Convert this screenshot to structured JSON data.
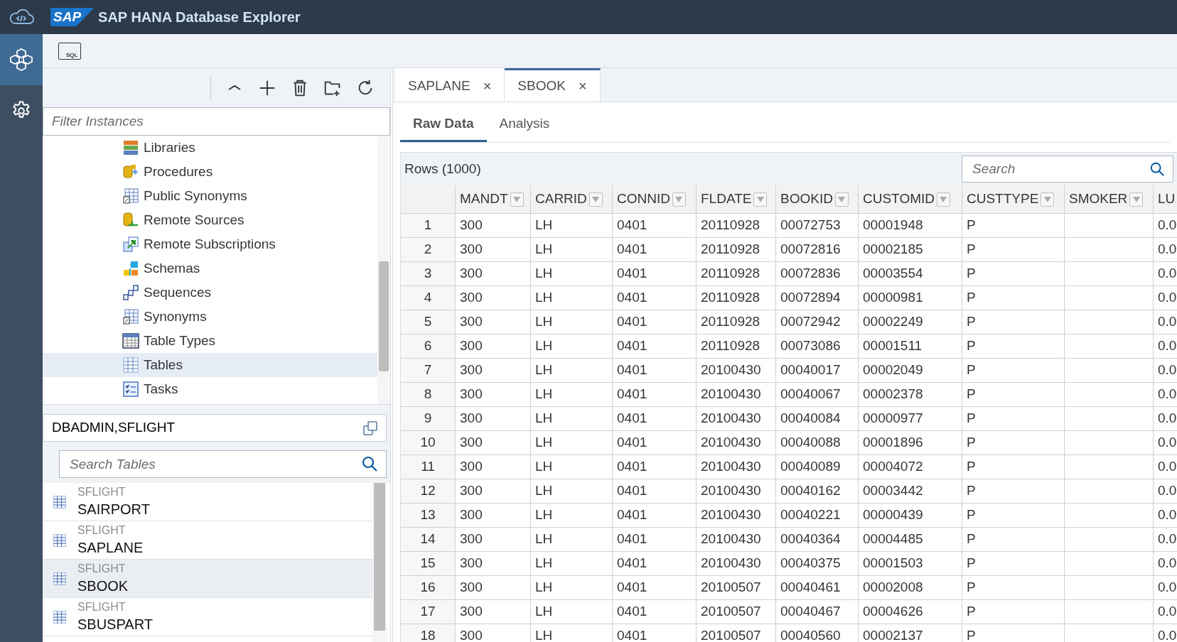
{
  "window": {
    "title": "SAP HANA Database Explorer",
    "logo": "SAP"
  },
  "rail": [
    {
      "selected": true
    },
    {
      "selected": false
    }
  ],
  "toolbar": {
    "sql_label": "SQL"
  },
  "filter": {
    "placeholder": "Filter Instances"
  },
  "tree": [
    {
      "label": "Libraries",
      "selected": false
    },
    {
      "label": "Procedures",
      "selected": false
    },
    {
      "label": "Public Synonyms",
      "selected": false
    },
    {
      "label": "Remote Sources",
      "selected": false
    },
    {
      "label": "Remote Subscriptions",
      "selected": false
    },
    {
      "label": "Schemas",
      "selected": false
    },
    {
      "label": "Sequences",
      "selected": false
    },
    {
      "label": "Synonyms",
      "selected": false
    },
    {
      "label": "Table Types",
      "selected": false
    },
    {
      "label": "Tables",
      "selected": true
    },
    {
      "label": "Tasks",
      "selected": false
    }
  ],
  "connection": {
    "label": "DBADMIN,SFLIGHT"
  },
  "table_search": {
    "placeholder": "Search Tables"
  },
  "table_list": [
    {
      "schema": "SFLIGHT",
      "name": "SAIRPORT",
      "selected": false
    },
    {
      "schema": "SFLIGHT",
      "name": "SAPLANE",
      "selected": false
    },
    {
      "schema": "SFLIGHT",
      "name": "SBOOK",
      "selected": true
    },
    {
      "schema": "SFLIGHT",
      "name": "SBUSPART",
      "selected": false
    }
  ],
  "tabs": [
    {
      "label": "SAPLANE",
      "close": "×",
      "selected": false
    },
    {
      "label": "SBOOK",
      "close": "×",
      "selected": true
    }
  ],
  "subtabs": [
    {
      "label": "Raw Data",
      "selected": true
    },
    {
      "label": "Analysis",
      "selected": false
    }
  ],
  "grid": {
    "row_count": "Rows (1000)",
    "search_placeholder": "Search",
    "columns": [
      "",
      "MANDT",
      "CARRID",
      "CONNID",
      "FLDATE",
      "BOOKID",
      "CUSTOMID",
      "CUSTTYPE",
      "SMOKER",
      "LU"
    ],
    "rows": [
      [
        "1",
        "300",
        "LH",
        "0401",
        "20110928",
        "00072753",
        "00001948",
        "P",
        "",
        "0.0"
      ],
      [
        "2",
        "300",
        "LH",
        "0401",
        "20110928",
        "00072816",
        "00002185",
        "P",
        "",
        "0.0"
      ],
      [
        "3",
        "300",
        "LH",
        "0401",
        "20110928",
        "00072836",
        "00003554",
        "P",
        "",
        "0.0"
      ],
      [
        "4",
        "300",
        "LH",
        "0401",
        "20110928",
        "00072894",
        "00000981",
        "P",
        "",
        "0.0"
      ],
      [
        "5",
        "300",
        "LH",
        "0401",
        "20110928",
        "00072942",
        "00002249",
        "P",
        "",
        "0.0"
      ],
      [
        "6",
        "300",
        "LH",
        "0401",
        "20110928",
        "00073086",
        "00001511",
        "P",
        "",
        "0.0"
      ],
      [
        "7",
        "300",
        "LH",
        "0401",
        "20100430",
        "00040017",
        "00002049",
        "P",
        "",
        "0.0"
      ],
      [
        "8",
        "300",
        "LH",
        "0401",
        "20100430",
        "00040067",
        "00002378",
        "P",
        "",
        "0.0"
      ],
      [
        "9",
        "300",
        "LH",
        "0401",
        "20100430",
        "00040084",
        "00000977",
        "P",
        "",
        "0.0"
      ],
      [
        "10",
        "300",
        "LH",
        "0401",
        "20100430",
        "00040088",
        "00001896",
        "P",
        "",
        "0.0"
      ],
      [
        "11",
        "300",
        "LH",
        "0401",
        "20100430",
        "00040089",
        "00004072",
        "P",
        "",
        "0.0"
      ],
      [
        "12",
        "300",
        "LH",
        "0401",
        "20100430",
        "00040162",
        "00003442",
        "P",
        "",
        "0.0"
      ],
      [
        "13",
        "300",
        "LH",
        "0401",
        "20100430",
        "00040221",
        "00000439",
        "P",
        "",
        "0.0"
      ],
      [
        "14",
        "300",
        "LH",
        "0401",
        "20100430",
        "00040364",
        "00004485",
        "P",
        "",
        "0.0"
      ],
      [
        "15",
        "300",
        "LH",
        "0401",
        "20100430",
        "00040375",
        "00001503",
        "P",
        "",
        "0.0"
      ],
      [
        "16",
        "300",
        "LH",
        "0401",
        "20100507",
        "00040461",
        "00002008",
        "P",
        "",
        "0.0"
      ],
      [
        "17",
        "300",
        "LH",
        "0401",
        "20100507",
        "00040467",
        "00004626",
        "P",
        "",
        "0.0"
      ],
      [
        "18",
        "300",
        "LH",
        "0401",
        "20100507",
        "00040560",
        "00002137",
        "P",
        "",
        "0.0"
      ]
    ]
  }
}
